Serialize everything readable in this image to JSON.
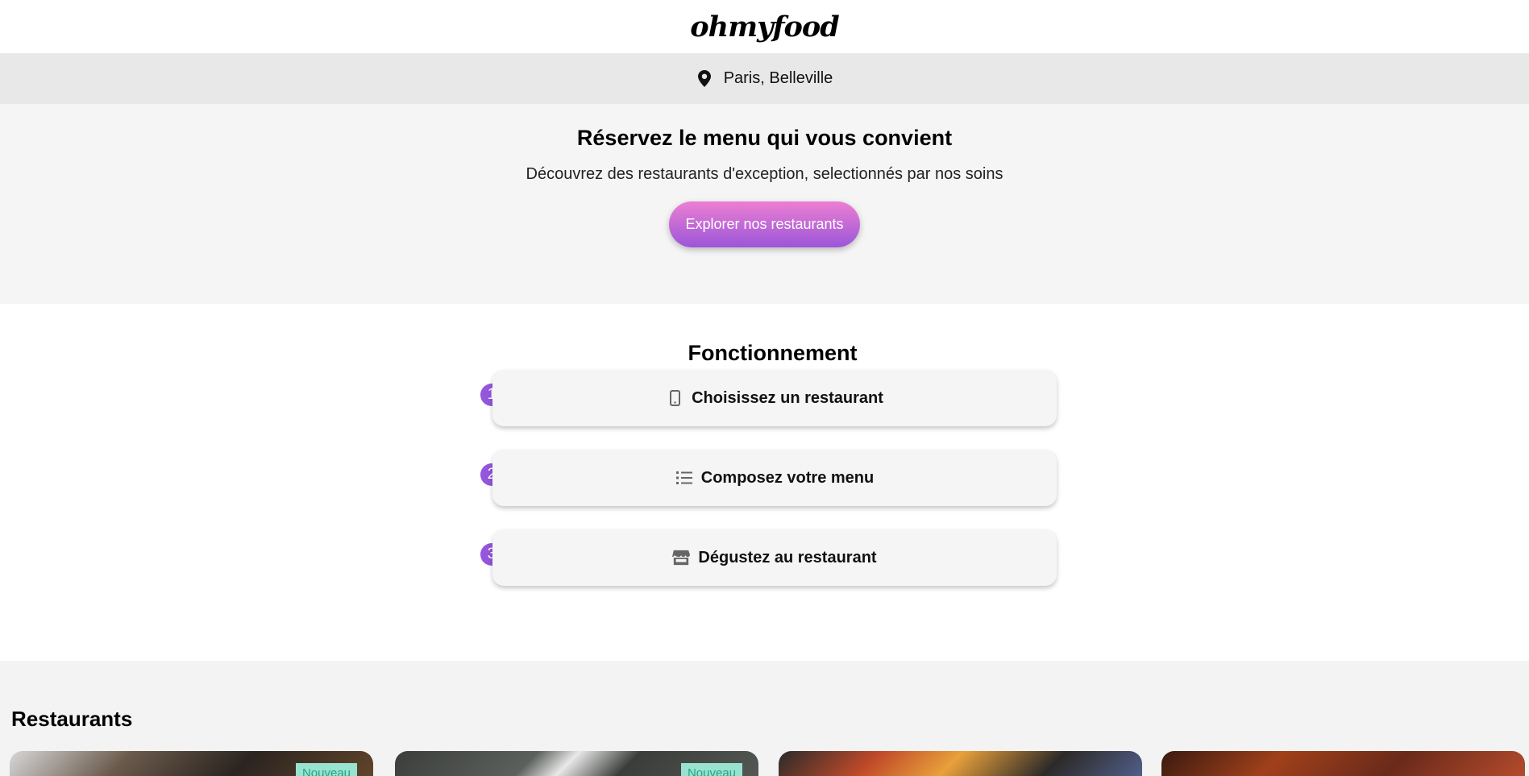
{
  "header": {
    "logo": "ohmyfood"
  },
  "location": {
    "icon": "map-pin-icon",
    "text": "Paris, Belleville"
  },
  "hero": {
    "title": "Réservez le menu qui vous convient",
    "subtitle": "Découvrez des restaurants d'exception, selectionnés par nos soins",
    "cta_label": "Explorer nos restaurants"
  },
  "how": {
    "title": "Fonctionnement",
    "steps": [
      {
        "number": "1",
        "label": "Choisissez un restaurant",
        "icon": "mobile-phone-icon"
      },
      {
        "number": "2",
        "label": "Composez votre menu",
        "icon": "list-icon"
      },
      {
        "number": "3",
        "label": "Dégustez au restaurant",
        "icon": "store-icon"
      }
    ]
  },
  "restaurants": {
    "title": "Restaurants",
    "cards": [
      {
        "badge": "Nouveau"
      },
      {
        "badge": "Nouveau"
      },
      {
        "badge": ""
      },
      {
        "badge": ""
      }
    ]
  },
  "colors": {
    "accent_purple": "#9356dc",
    "accent_pink": "#ec7fd2",
    "badge_green": "#99e2d0",
    "badge_text": "#24a586"
  }
}
